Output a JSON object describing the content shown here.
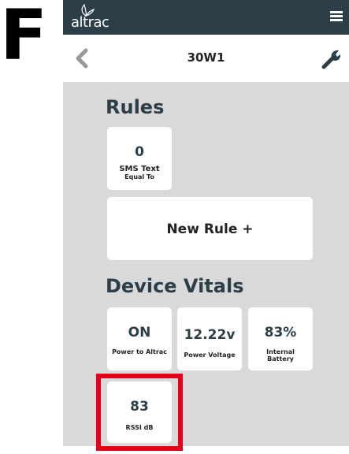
{
  "figure": {
    "letter": "F"
  },
  "app": {
    "brand": "altrac",
    "menu_icon": "hamburger-menu-icon"
  },
  "nav": {
    "title": "30W1",
    "back_icon": "chevron-left-icon",
    "settings_icon": "wrench-icon"
  },
  "rules": {
    "title": "Rules",
    "cards": [
      {
        "value": "0",
        "label": "SMS Text",
        "sublabel": "Equal To"
      }
    ],
    "new_rule_label": "New Rule +"
  },
  "vitals": {
    "title": "Device Vitals",
    "cards": [
      {
        "value": "ON",
        "label": "Power to Altrac"
      },
      {
        "value": "12.22v",
        "label": "Power Voltage"
      },
      {
        "value": "83%",
        "label": "Internal Battery"
      },
      {
        "value": "83",
        "label": "RSSI dB"
      }
    ]
  },
  "colors": {
    "topbar": "#2c3e48",
    "background": "#d9d9d9",
    "highlight": "#e3001b"
  }
}
